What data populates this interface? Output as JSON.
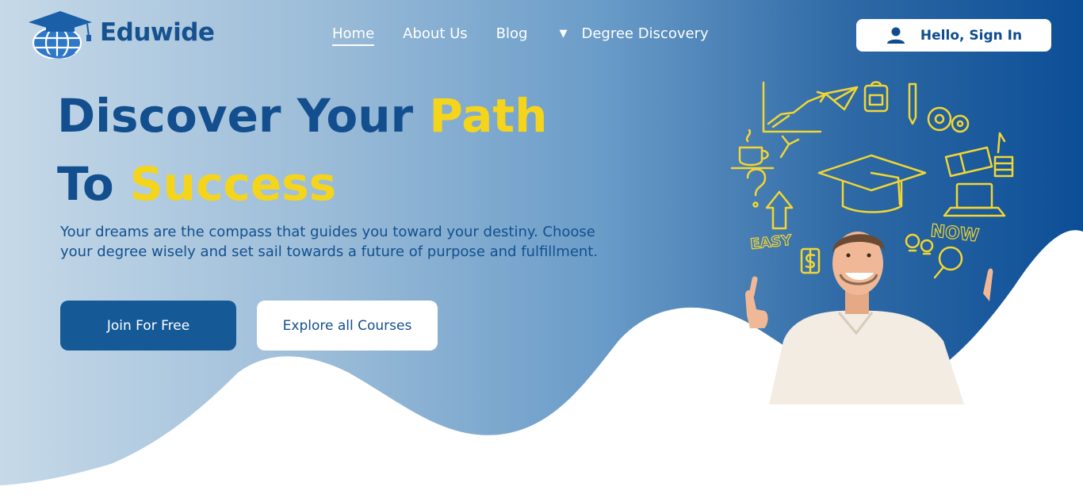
{
  "brand": {
    "name": "Eduwide"
  },
  "nav": {
    "links": [
      "Home",
      "About Us",
      "Blog"
    ],
    "dropdown_label": "Degree Discovery",
    "active": "Home"
  },
  "signin": {
    "label": "Hello, Sign In"
  },
  "hero": {
    "headline_line1_prefix": "Discover Your ",
    "headline_line1_highlight": "Path",
    "headline_line2_prefix": "To ",
    "headline_line2_highlight": "Success",
    "description": "Your dreams are the compass that guides you toward your destiny. Choose your degree wisely and set sail towards a future of purpose and fulfillment.",
    "primary_button": "Join For Free",
    "secondary_button": "Explore all Courses"
  },
  "illustration": {
    "doodle_words": [
      "EASY",
      "NOW"
    ],
    "icons": [
      "graduation-cap-icon",
      "growth-chart-icon",
      "paper-plane-icon",
      "backpack-icon",
      "pencil-icon",
      "gears-icon",
      "coffee-cup-icon",
      "books-icon",
      "laptop-icon",
      "question-mark-icon",
      "arrow-up-icon",
      "lightbulb-icon",
      "magnifier-icon",
      "dollar-icon"
    ]
  },
  "colors": {
    "brand_blue": "#134f8e",
    "accent_yellow": "#f5d51b",
    "nav_text": "#ffffff",
    "gradient_start": "#c6d9e8",
    "gradient_end": "#0c4e96"
  }
}
